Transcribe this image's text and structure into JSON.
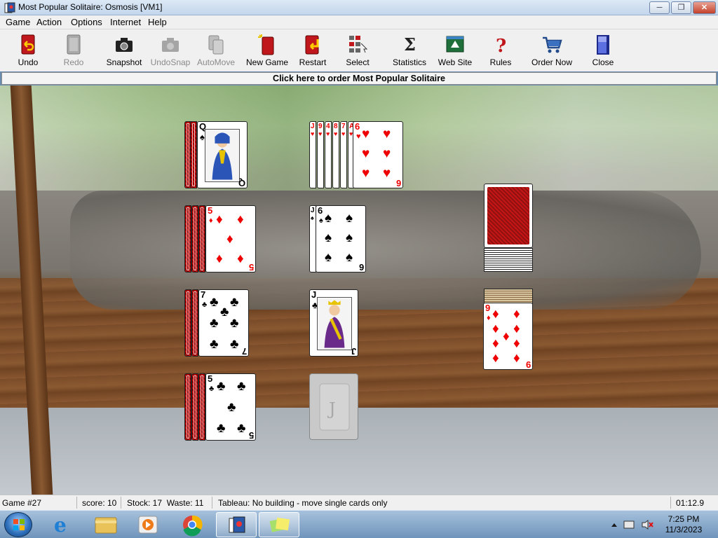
{
  "window": {
    "title": "Most Popular Solitaire: Osmosis [VM1]",
    "min_label": "─",
    "max_label": "❐",
    "close_label": "✕"
  },
  "menu": [
    "Game",
    "Action",
    "Options",
    "Internet",
    "Help"
  ],
  "toolbar": [
    {
      "label": "Undo",
      "icon": "undo-icon",
      "enabled": true
    },
    {
      "label": "Redo",
      "icon": "redo-icon",
      "enabled": false
    },
    {
      "label": "Snapshot",
      "icon": "camera-icon",
      "enabled": true
    },
    {
      "label": "UndoSnap",
      "icon": "camera-undo-icon",
      "enabled": false
    },
    {
      "label": "AutoMove",
      "icon": "automove-icon",
      "enabled": false
    },
    {
      "label": "New Game",
      "icon": "new-game-icon",
      "enabled": true
    },
    {
      "label": "Restart",
      "icon": "restart-icon",
      "enabled": true
    },
    {
      "label": "Select",
      "icon": "select-icon",
      "enabled": true
    },
    {
      "label": "Statistics",
      "icon": "sigma-icon",
      "enabled": true
    },
    {
      "label": "Web Site",
      "icon": "website-icon",
      "enabled": true
    },
    {
      "label": "Rules",
      "icon": "question-icon",
      "enabled": true
    },
    {
      "label": "Order Now",
      "icon": "cart-icon",
      "enabled": true
    },
    {
      "label": "Close",
      "icon": "close-door-icon",
      "enabled": true
    }
  ],
  "banner": "Click here to order Most Popular Solitaire",
  "reserve_piles": [
    {
      "stub_ranks": [],
      "top": {
        "rank": "Q",
        "suit": "♠",
        "color": "black",
        "face": true
      }
    },
    {
      "stub_ranks": [],
      "top": {
        "rank": "5",
        "suit": "♦",
        "color": "red"
      }
    },
    {
      "stub_ranks": [],
      "top": {
        "rank": "7",
        "suit": "♣",
        "color": "black"
      }
    },
    {
      "stub_ranks": [],
      "top": {
        "rank": "5",
        "suit": "♣",
        "color": "black"
      }
    }
  ],
  "foundations": [
    {
      "stub_ranks": [
        "J",
        "9",
        "4",
        "8",
        "7",
        "A"
      ],
      "stub_color": "red",
      "stub_suit": "♥",
      "top": {
        "rank": "6",
        "suit": "♥",
        "color": "red"
      }
    },
    {
      "stub_ranks": [
        "J"
      ],
      "stub_color": "black",
      "stub_suit": "♠",
      "top": {
        "rank": "6",
        "suit": "♠",
        "color": "black"
      }
    },
    {
      "stub_ranks": [],
      "top": {
        "rank": "J",
        "suit": "♣",
        "color": "black",
        "face": true
      }
    },
    {
      "empty_label": "J"
    }
  ],
  "waste_top": {
    "rank": "9",
    "suit": "♦",
    "color": "red"
  },
  "status": {
    "game": "Game #27",
    "score": "score: 10",
    "stock_waste": "Stock: 17  Waste: 11",
    "message": "Tableau: No building - move single cards only",
    "timer": "01:12.9"
  },
  "taskbar": {
    "apps": [
      "ie-icon",
      "explorer-icon",
      "media-player-icon",
      "chrome-icon",
      "solitaire-icon",
      "sticky-notes-icon"
    ],
    "time": "7:25 PM",
    "date": "11/3/2023"
  }
}
